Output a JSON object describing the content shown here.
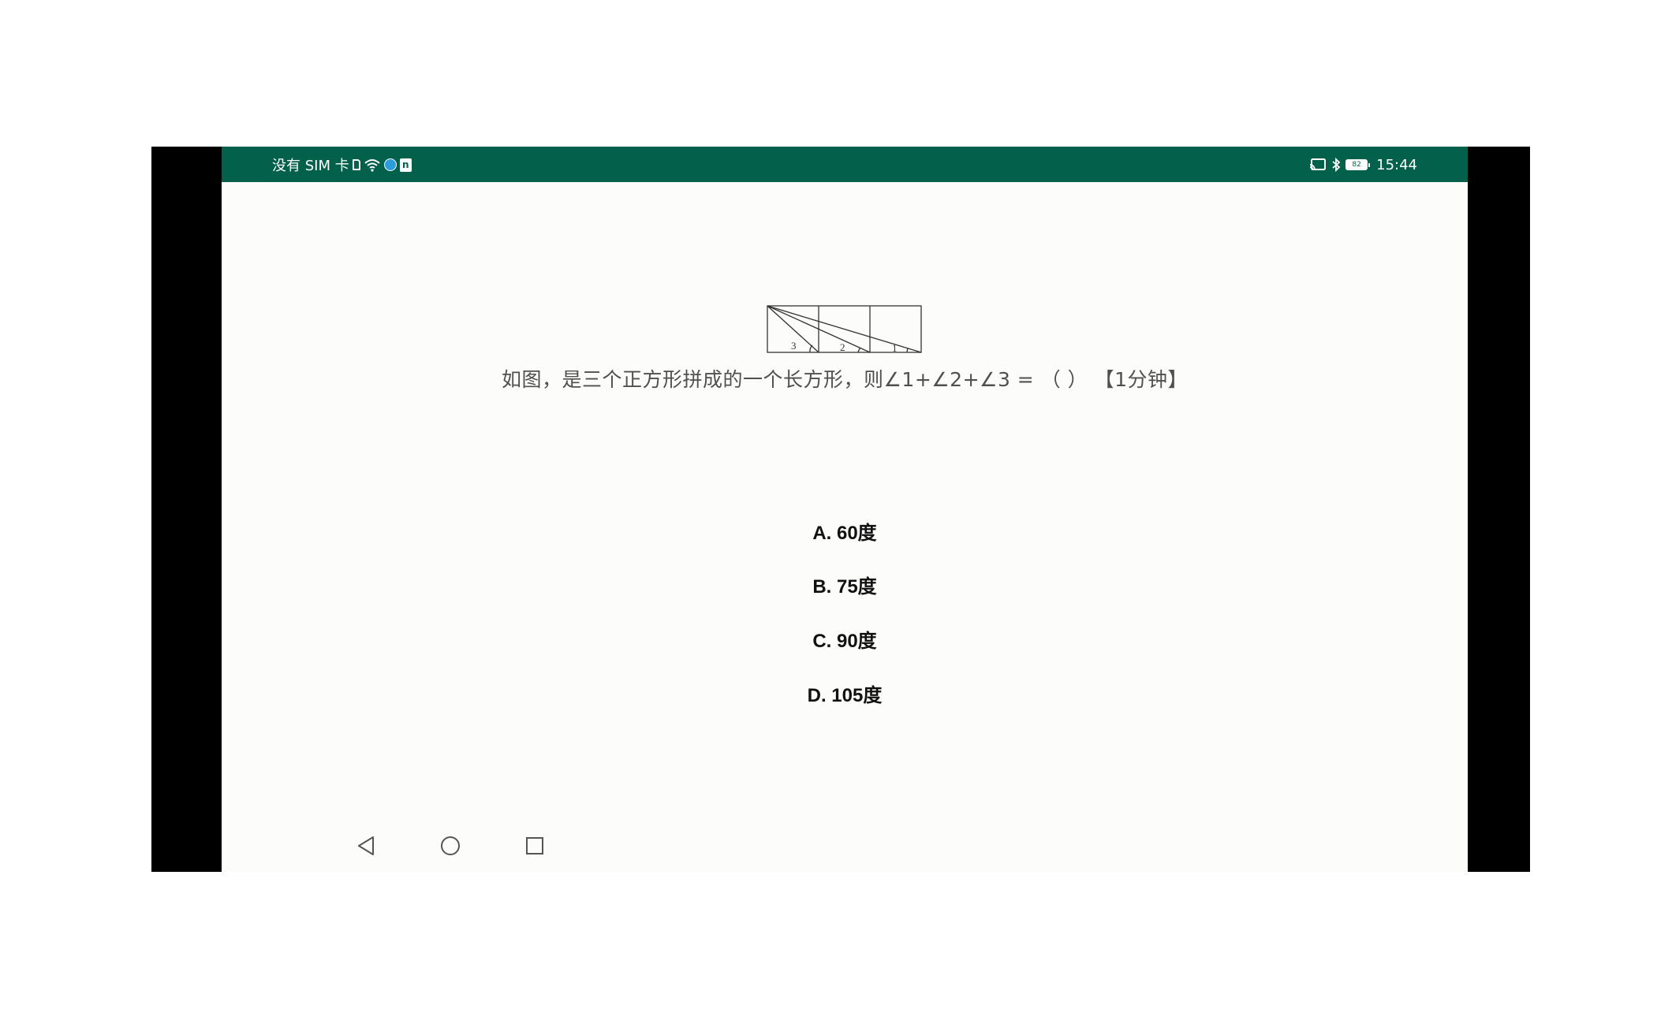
{
  "status_bar": {
    "carrier_text": "没有 SIM 卡",
    "time": "15:44",
    "battery_level": "82",
    "notification_badge": "n",
    "icons_left": [
      "sim-icon",
      "wifi-icon",
      "app-badge-icon",
      "notification-icon"
    ],
    "icons_right": [
      "cast-icon",
      "bluetooth-icon",
      "battery-icon"
    ]
  },
  "figure": {
    "angle_labels": [
      "3",
      "2",
      "1"
    ]
  },
  "question": {
    "text": "如图，是三个正方形拼成的一个长方形，则∠1+∠2+∠3 = （ ） 【1分钟】"
  },
  "options": [
    {
      "label": "A. 60度"
    },
    {
      "label": "B. 75度"
    },
    {
      "label": "C. 90度"
    },
    {
      "label": "D. 105度"
    }
  ],
  "nav_bar": {
    "buttons": [
      "back-icon",
      "home-icon",
      "recents-icon"
    ]
  },
  "colors": {
    "status_bar": "#03604a",
    "screen_bg": "#fcfcfb",
    "frame": "#000000",
    "question_text": "#505050",
    "option_text": "#111111"
  }
}
